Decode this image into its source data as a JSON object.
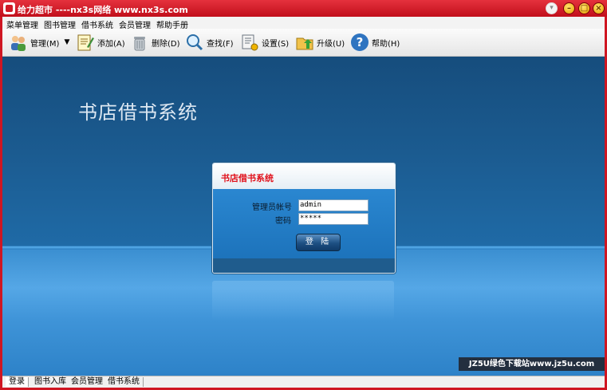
{
  "window": {
    "title": "给力超市 ----nx3s网络 www.nx3s.com",
    "buttons": [
      "context",
      "minimize",
      "maximize",
      "close"
    ]
  },
  "menu": [
    "菜单管理",
    "图书管理",
    "借书系统",
    "会员管理",
    "帮助手册"
  ],
  "toolbar": {
    "items": [
      {
        "label": "管理(M)",
        "icon": "users-icon"
      },
      {
        "label": "添加(A)",
        "icon": "notepad-icon"
      },
      {
        "label": "删除(D)",
        "icon": "trash-icon"
      },
      {
        "label": "查找(F)",
        "icon": "magnifier-icon"
      },
      {
        "label": "设置(S)",
        "icon": "settings-icon"
      },
      {
        "label": "升级(U)",
        "icon": "folder-upgrade-icon"
      },
      {
        "label": "帮助(H)",
        "icon": "help-icon"
      }
    ]
  },
  "stage": {
    "title": "书店借书系统"
  },
  "login": {
    "header": "书店借书系统",
    "account_label": "管理员帐号",
    "account_value": "admin",
    "password_label": "密码",
    "password_value": "*****",
    "submit_label": "登 陆"
  },
  "status_tabs": [
    "登录",
    "图书入库",
    "会员管理",
    "借书系统"
  ],
  "watermark": "JZ5U绿色下载站www.jz5u.com",
  "colors": {
    "title_bar": "#cf1622",
    "login_header_text": "#e0101a",
    "background_blue": "#1b5b90"
  }
}
